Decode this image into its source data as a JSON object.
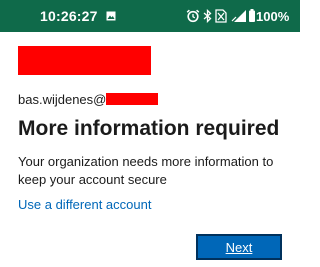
{
  "status_bar": {
    "time": "10:26:27",
    "battery": "100%",
    "background_color": "#0f6a4a",
    "icons": [
      "image-notification-icon",
      "alarm-icon",
      "bluetooth-icon",
      "no-sim-icon",
      "signal-icon",
      "battery-icon"
    ]
  },
  "account": {
    "username_prefix": "bas.wijdenes@",
    "redaction_color": "#ff0000"
  },
  "page": {
    "title": "More information required",
    "description": "Your organization needs more information to keep your account secure",
    "alt_account_link": "Use a different account",
    "link_color": "#0067b8"
  },
  "actions": {
    "next_label": "Next",
    "next_color": "#0067b8"
  }
}
